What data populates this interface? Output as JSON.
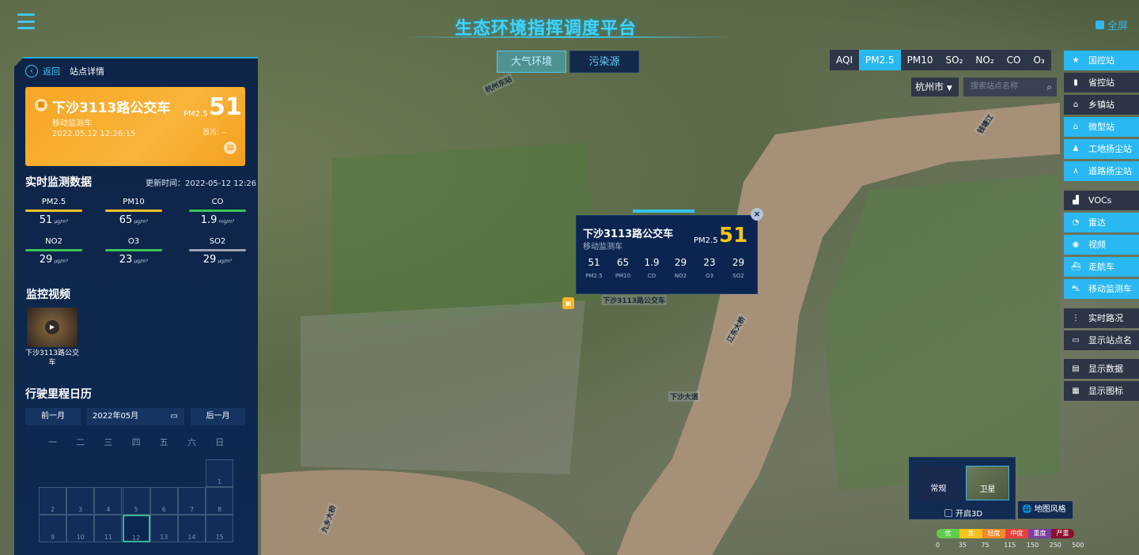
{
  "header": {
    "title": "生态环境指挥调度平台",
    "tabs": [
      "大气环境",
      "污染源"
    ],
    "fullscreen": "全屏"
  },
  "panel": {
    "back": "返回",
    "crumb": "站点详情",
    "station": {
      "name": "下沙3113路公交车",
      "type": "移动监测车",
      "time": "2022.05.12 12:26:15",
      "metric": "PM2.5",
      "value": "51",
      "primary": "首污: --",
      "status_color": "#f6a623"
    },
    "realtime": {
      "title": "实时监测数据",
      "updated": "更新时间：2022-05-12 12:26",
      "items": [
        {
          "name": "PM2.5",
          "value": "51",
          "unit": "μg/m³",
          "color": "#f2c12e"
        },
        {
          "name": "PM10",
          "value": "65",
          "unit": "μg/m³",
          "color": "#f2c12e"
        },
        {
          "name": "CO",
          "value": "1.9",
          "unit": "mg/m³",
          "color": "#3cc35a"
        },
        {
          "name": "NO2",
          "value": "29",
          "unit": "μg/m³",
          "color": "#3cc35a"
        },
        {
          "name": "O3",
          "value": "23",
          "unit": "μg/m³",
          "color": "#3cc35a"
        },
        {
          "name": "SO2",
          "value": "29",
          "unit": "μg/m³",
          "color": "#9ea3b0"
        }
      ]
    },
    "video": {
      "title": "监控视频",
      "caption": "下沙3113路公交车"
    },
    "calendar": {
      "title": "行驶里程日历",
      "prev": "前一月",
      "next": "后一月",
      "month": "2022年05月",
      "weekdays": [
        "一",
        "二",
        "三",
        "四",
        "五",
        "六",
        "日"
      ],
      "days": [
        "1",
        "2",
        "3",
        "4",
        "5",
        "6",
        "7",
        "8",
        "9",
        "10",
        "11",
        "12",
        "13",
        "14",
        "15"
      ],
      "selected": "12"
    }
  },
  "pollutant_tabs": {
    "items": [
      "AQI",
      "PM2.5",
      "PM10",
      "SO₂",
      "NO₂",
      "CO",
      "O₃"
    ],
    "active": "PM2.5"
  },
  "filter": {
    "city": "杭州市",
    "search_placeholder": "搜索站点名称"
  },
  "sidebar": [
    {
      "label": "国控站",
      "icon": "star-icon",
      "active": true
    },
    {
      "label": "省控站",
      "icon": "building-icon",
      "active": false
    },
    {
      "label": "乡镇站",
      "icon": "bank-icon",
      "active": false
    },
    {
      "label": "微型站",
      "icon": "house-icon",
      "active": true
    },
    {
      "label": "工地扬尘站",
      "icon": "worker-icon",
      "active": true
    },
    {
      "label": "道路扬尘站",
      "icon": "road-icon",
      "active": true
    },
    {
      "label": "VOCs",
      "icon": "factory-icon",
      "active": false
    },
    {
      "label": "雷达",
      "icon": "radar-icon",
      "active": true
    },
    {
      "label": "视频",
      "icon": "camera-icon",
      "active": true
    },
    {
      "label": "走航车",
      "icon": "ship-icon",
      "active": true
    },
    {
      "label": "移动监测车",
      "icon": "car-icon",
      "active": true
    },
    {
      "label": "实时路况",
      "icon": "traffic-light-icon",
      "active": false
    },
    {
      "label": "显示站点名",
      "icon": "monitor-icon",
      "active": false
    },
    {
      "label": "显示数据",
      "icon": "data-icon",
      "active": false
    },
    {
      "label": "显示图标",
      "icon": "grid-icon",
      "active": false
    }
  ],
  "popup": {
    "name": "下沙3113路公交车",
    "type": "移动监测车",
    "metric": "PM2.5",
    "value": "51",
    "value_color": "#f5c518",
    "items": [
      {
        "v": "51",
        "n": "PM2.5"
      },
      {
        "v": "65",
        "n": "PM10"
      },
      {
        "v": "1.9",
        "n": "CO"
      },
      {
        "v": "29",
        "n": "NO2"
      },
      {
        "v": "23",
        "n": "O3"
      },
      {
        "v": "29",
        "n": "SO2"
      }
    ]
  },
  "map_switch": {
    "normal": "常规",
    "satellite": "卫星",
    "active": "卫星",
    "toggle3d": "开启3D",
    "style": "地图风格"
  },
  "legend": {
    "levels": [
      {
        "label": "优",
        "color": "#5fce47"
      },
      {
        "label": "良",
        "color": "#f7c21c"
      },
      {
        "label": "轻度",
        "color": "#f58a2a"
      },
      {
        "label": "中度",
        "color": "#e8413b"
      },
      {
        "label": "重度",
        "color": "#7a3fa0"
      },
      {
        "label": "严重",
        "color": "#8c0f2c"
      }
    ],
    "ticks": [
      "0",
      "35",
      "75",
      "115",
      "150",
      "250",
      "500"
    ]
  },
  "map_labels": [
    "下沙3113路公交车",
    "江东大桥",
    "钱塘江",
    "九乡大桥",
    "下沙大道",
    "杭州东站"
  ]
}
